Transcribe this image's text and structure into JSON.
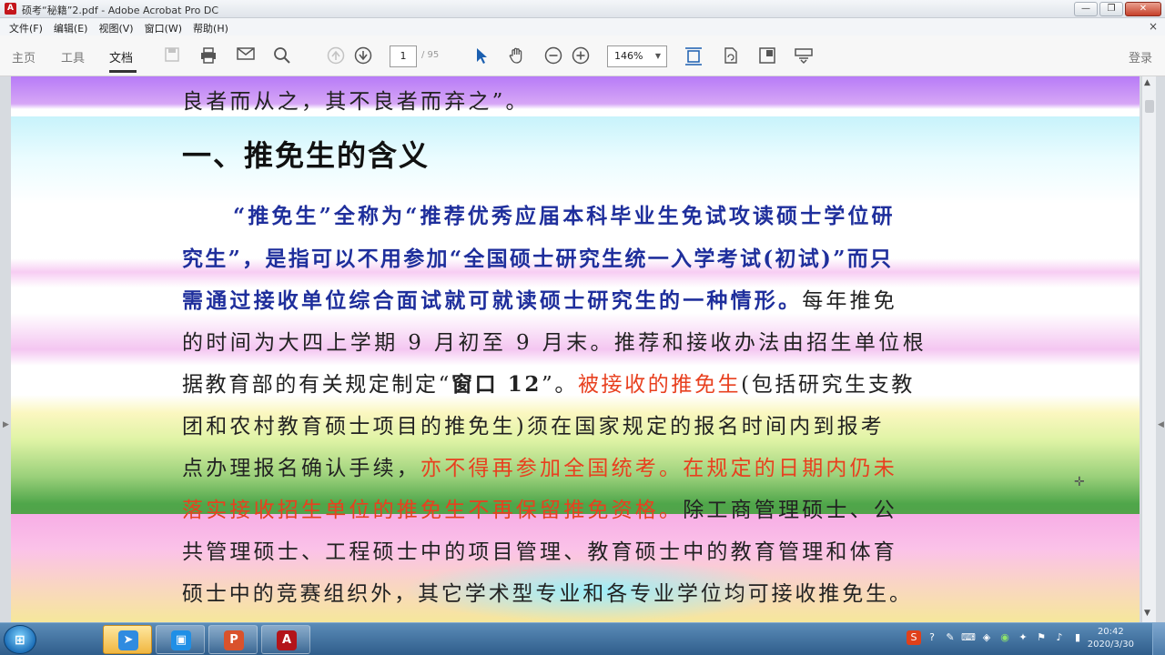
{
  "window": {
    "title": "硕考“秘籍”2.pdf - Adobe Acrobat Pro DC",
    "minimize": "—",
    "restore": "❐",
    "close": "✕"
  },
  "menu": [
    "文件(F)",
    "编辑(E)",
    "视图(V)",
    "窗口(W)",
    "帮助(H)"
  ],
  "menu_close": "×",
  "tabs": {
    "home": "主页",
    "tools": "工具",
    "document": "文档"
  },
  "toolbar": {
    "page_current": "1",
    "page_total": "/ 95",
    "zoom": "146%",
    "signin": "登录"
  },
  "icons": {
    "save": "save-icon",
    "print": "print-icon",
    "mail": "mail-icon",
    "search": "search-icon",
    "prev": "page-up-icon",
    "next": "page-down-icon",
    "select": "select-arrow-icon",
    "hand": "hand-icon",
    "zoom_out": "zoom-out-icon",
    "zoom_in": "zoom-in-icon"
  },
  "document": {
    "line0": "良者而从之，其不良者而弃之”。",
    "heading": "一、推免生的含义",
    "line1": "“推免生”全称为“推荐优秀应届本科毕业生免试攻读硕士学位研",
    "line2": "究生”，是指可以不用参加“全国硕士研究生统一入学考试(初试)”而只",
    "line3a": "需通过接收单位综合面试就可就读硕士研究生的一种情形。",
    "line3b": "每年推免",
    "line4": "的时间为大四上学期 9 月初至 9 月末。推荐和接收办法由招生单位根",
    "line5a": "据教育部的有关规定制定“",
    "line5b": "窗口 12",
    "line5c": "”。",
    "line5d": "被接收的推免生",
    "line5e": "(包括研究生支教",
    "line6": "团和农村教育硕士项目的推免生)须在国家规定的报名时间内到报考",
    "line7a": "点办理报名确认手续，",
    "line7b": "亦不得再参加全国统考。在规定的日期内仍未",
    "line8a": "落实接收招生单位的推免生不再保留推免资格。",
    "line8b": "除工商管理硕士、公",
    "line9": "共管理硕士、工程硕士中的项目管理、教育硕士中的教育管理和体育",
    "line10": "硕士中的竞赛组织外，其它学术型专业和各专业学位均可接收推免生。"
  },
  "taskbar": {
    "clock_time": "20:42",
    "clock_date": "2020/3/30"
  },
  "colors": {
    "accent_red": "#e8401f",
    "text_blue": "#1f2f9c"
  }
}
